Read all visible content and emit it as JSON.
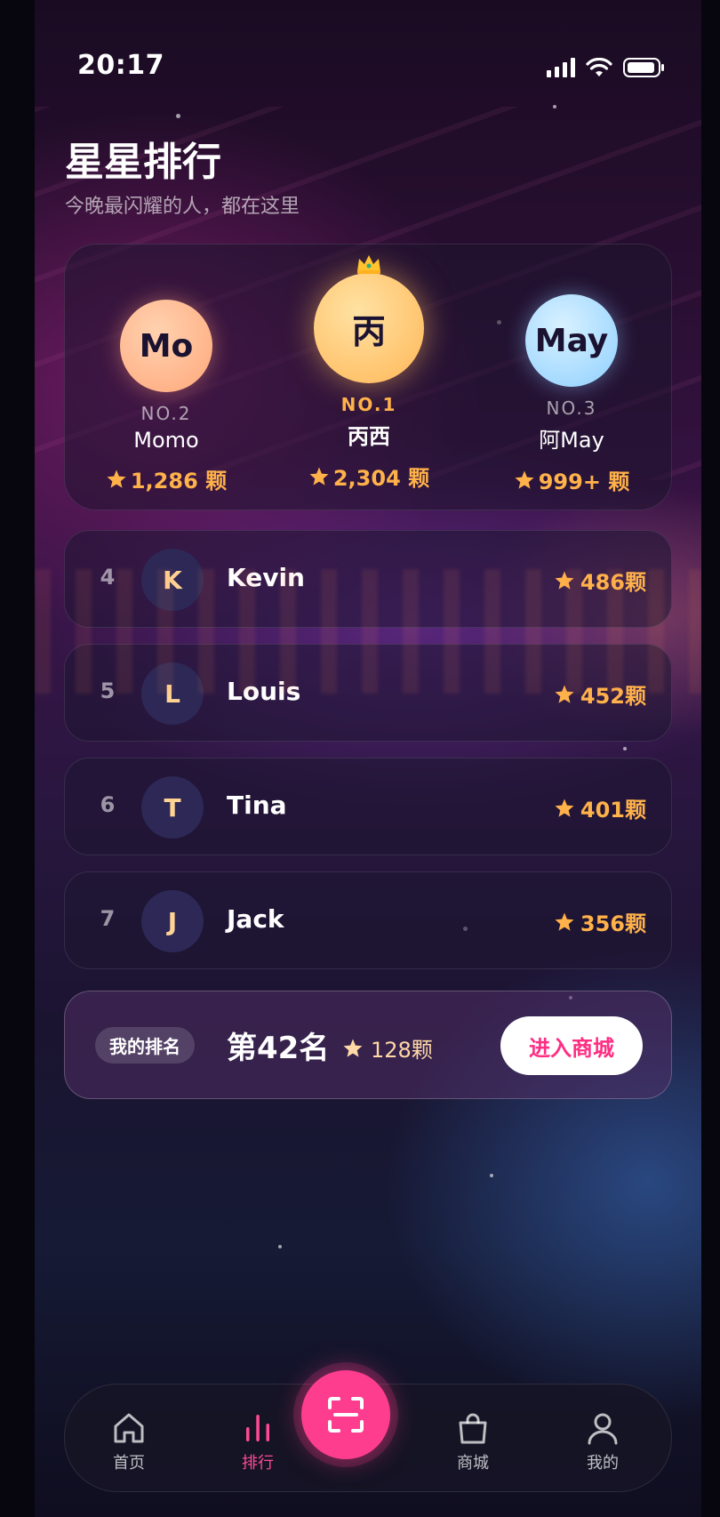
{
  "status": {
    "time": "20:17"
  },
  "header": {
    "title": "星星排行",
    "subtitle": "今晚最闪耀的人，都在这里"
  },
  "podium": [
    {
      "rank_label": "NO.2",
      "avatar_text": "Mo",
      "name": "Momo",
      "stars": "1,286 颗"
    },
    {
      "rank_label": "NO.1",
      "avatar_text": "丙",
      "name": "丙西",
      "stars": "2,304 颗"
    },
    {
      "rank_label": "NO.3",
      "avatar_text": "May",
      "name": "阿May",
      "stars": "999+ 颗"
    }
  ],
  "ranking": [
    {
      "rank": "4",
      "initial": "K",
      "name": "Kevin",
      "stars": "486颗"
    },
    {
      "rank": "5",
      "initial": "L",
      "name": "Louis",
      "stars": "452颗"
    },
    {
      "rank": "6",
      "initial": "T",
      "name": "Tina",
      "stars": "401颗"
    },
    {
      "rank": "7",
      "initial": "J",
      "name": "Jack",
      "stars": "356颗"
    }
  ],
  "my_rank": {
    "tag": "我的排名",
    "rank": "第42名",
    "stars": "128颗",
    "button": "进入商城"
  },
  "tabbar": {
    "home": "首页",
    "ranking": "排行",
    "shop": "商城",
    "profile": "我的"
  },
  "colors": {
    "accent": "#ff3d8f",
    "star": "#ffb14a",
    "gold_avatar": "#ffc86a",
    "silver_avatar": "#ffb48a",
    "bronze_avatar": "#a8dcff"
  },
  "icons": [
    "signal-icon",
    "wifi-icon",
    "battery-icon",
    "crown-icon",
    "star-icon",
    "home-icon",
    "ranking-icon",
    "scan-icon",
    "shop-bag-icon",
    "profile-icon"
  ]
}
